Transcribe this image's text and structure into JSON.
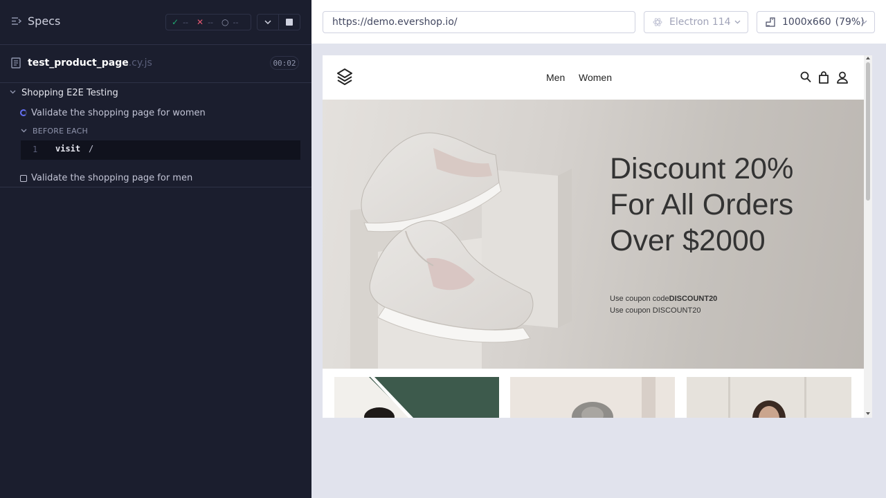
{
  "reporter": {
    "specs_label": "Specs",
    "stats": {
      "passed": "--",
      "failed": "--",
      "pending": "--"
    },
    "spec": {
      "name": "test_product_page",
      "ext": ".cy.js",
      "duration": "00:02"
    },
    "suite": {
      "title": "Shopping E2E Testing",
      "tests": [
        {
          "title": "Validate the shopping page for women",
          "status": "running",
          "hook": {
            "title": "BEFORE EACH",
            "commands": [
              {
                "number": "1",
                "name": "visit",
                "arg": "/"
              }
            ]
          }
        },
        {
          "title": "Validate the shopping page for men",
          "status": "pending"
        }
      ]
    }
  },
  "topbar": {
    "url": "https://demo.evershop.io/",
    "browser": "Electron 114",
    "viewport": "1000x660",
    "scale": "(79%)"
  },
  "aut": {
    "nav": {
      "men": "Men",
      "women": "Women"
    },
    "hero": {
      "title": "Discount 20% For All Orders Over $2000",
      "coupon_prefix": "Use coupon code",
      "coupon_code": "DISCOUNT20",
      "coupon_line2": "Use coupon DISCOUNT20"
    }
  },
  "colors": {
    "reporter_bg": "#1b1e2e",
    "pass": "#1fa971",
    "fail": "#e45770",
    "running": "#6470f3",
    "hero_bg": "#d6d2ce"
  }
}
